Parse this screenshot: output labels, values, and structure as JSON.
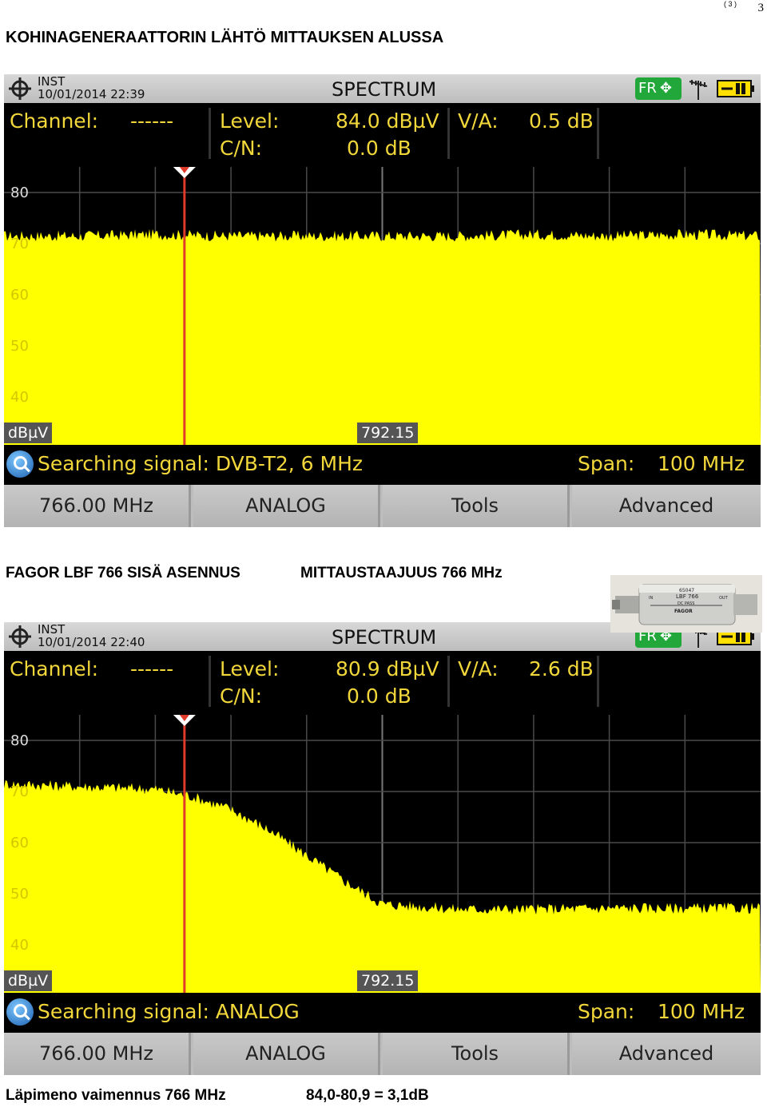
{
  "page": {
    "number_small": "( 3 )",
    "number": "3"
  },
  "title": "KOHINAGENERAATTORIN LÄHTÖ MITTAUKSEN ALUSSA",
  "caption_mid_left": "FAGOR LBF 766 SISÄ ASENNUS",
  "caption_mid_right": "MITTAUSTAAJUUS 766 MHz",
  "caption_bottom_left": "Läpimeno vaimennus 766 MHz",
  "caption_bottom_right": "84,0-80,9 = 3,1dB",
  "product_photo": {
    "lines": [
      "65047",
      "LBF 766",
      "IN",
      "OUT",
      "DC PASS",
      "FAGOR"
    ]
  },
  "screens": [
    {
      "inst_label": "INST",
      "datetime": "10/01/2014 22:39",
      "title": "SPECTRUM",
      "fr_badge": "FR",
      "channel_label": "Channel:",
      "channel_value": "------",
      "level_label": "Level:",
      "level_value": "84.0 dBµV",
      "va_label": "V/A:",
      "va_value": "0.5 dB",
      "cn_label": "C/N:",
      "cn_value": "0.0 dB",
      "y_ticks": [
        "80",
        "70",
        "60",
        "50",
        "40"
      ],
      "unit": "dBµV",
      "center_freq": "792.15",
      "status": "Searching signal: DVB-T2, 6 MHz",
      "span_label": "Span:",
      "span_value": "100 MHz",
      "softkeys": [
        "766.00 MHz",
        "ANALOG",
        "Tools",
        "Advanced"
      ]
    },
    {
      "inst_label": "INST",
      "datetime": "10/01/2014 22:40",
      "title": "SPECTRUM",
      "fr_badge": "FR",
      "channel_label": "Channel:",
      "channel_value": "------",
      "level_label": "Level:",
      "level_value": "80.9 dBµV",
      "va_label": "V/A:",
      "va_value": "2.6 dB",
      "cn_label": "C/N:",
      "cn_value": "0.0 dB",
      "y_ticks": [
        "80",
        "70",
        "60",
        "50",
        "40"
      ],
      "unit": "dBµV",
      "center_freq": "792.15",
      "status": "Searching signal: ANALOG",
      "span_label": "Span:",
      "span_value": "100 MHz",
      "softkeys": [
        "766.00 MHz",
        "ANALOG",
        "Tools",
        "Advanced"
      ]
    }
  ],
  "colors": {
    "trace": "#ffff00",
    "marker": "#e03a2a",
    "readout": "#f2d73b",
    "badge": "#22a83a"
  },
  "chart_data": [
    {
      "type": "area",
      "x_span_mhz": 100,
      "x_center_mhz": 792.15,
      "marker_mhz": 766.0,
      "ylim": [
        35,
        85
      ],
      "y_unit": "dBµV",
      "x": [
        742.15,
        752.15,
        762.15,
        772.15,
        782.15,
        792.15,
        802.15,
        812.15,
        822.15,
        832.15,
        842.15
      ],
      "values": [
        71.5,
        71.5,
        71.8,
        71.5,
        71.5,
        71.5,
        71.5,
        71.8,
        71.5,
        71.8,
        71.5
      ],
      "level_dbuv": 84.0
    },
    {
      "type": "area",
      "x_span_mhz": 100,
      "x_center_mhz": 792.15,
      "marker_mhz": 766.0,
      "ylim": [
        35,
        85
      ],
      "y_unit": "dBµV",
      "x": [
        742.15,
        752.15,
        762.15,
        767.15,
        772.15,
        777.15,
        782.15,
        787.15,
        792.15,
        802.15,
        812.15,
        822.15,
        832.15,
        842.15
      ],
      "values": [
        71.5,
        71.0,
        70.5,
        69.0,
        66.5,
        62.5,
        57.5,
        52.5,
        48.0,
        47.0,
        47.0,
        47.2,
        47.2,
        47.2
      ],
      "level_dbuv": 80.9
    }
  ]
}
